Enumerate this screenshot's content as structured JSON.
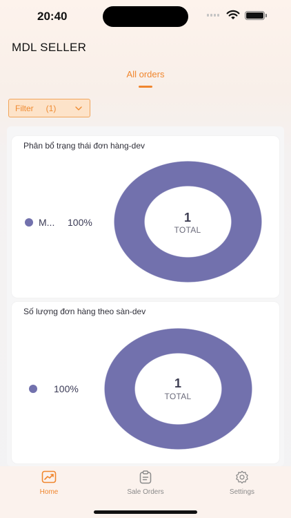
{
  "status": {
    "time": "20:40"
  },
  "header": {
    "title": "MDL SELLER"
  },
  "tabs": [
    {
      "label": "All orders",
      "active": true
    }
  ],
  "filter": {
    "label": "Filter",
    "count": "(1)"
  },
  "charts": [
    {
      "title": "Phân bổ trạng thái đơn hàng-dev",
      "legend": {
        "label": "M...",
        "percent": "100%"
      },
      "center_value": "1",
      "center_label": "TOTAL"
    },
    {
      "title": "Số lượng đơn hàng theo sàn-dev",
      "legend": {
        "label": "",
        "percent": "100%"
      },
      "center_value": "1",
      "center_label": "TOTAL"
    }
  ],
  "bottom_nav": [
    {
      "label": "Home",
      "icon": "chart-line-icon",
      "active": true
    },
    {
      "label": "Sale Orders",
      "icon": "clipboard-icon",
      "active": false
    },
    {
      "label": "Settings",
      "icon": "gear-icon",
      "active": false
    }
  ],
  "colors": {
    "accent": "#f0862e",
    "series": "#7271ad",
    "inactive": "#8a8a8a"
  }
}
